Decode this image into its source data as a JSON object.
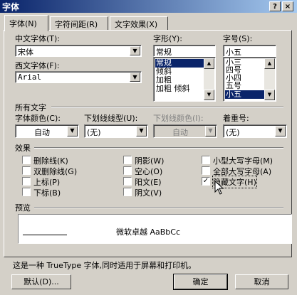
{
  "window": {
    "title": "字体",
    "help_glyph": "?",
    "close_glyph": "×"
  },
  "tabs": [
    {
      "label": "字体(N)",
      "active": true
    },
    {
      "label": "字符间距(R)",
      "active": false
    },
    {
      "label": "文字效果(X)",
      "active": false
    }
  ],
  "fields": {
    "chinese_font_label": "中文字体(T):",
    "chinese_font_value": "宋体",
    "western_font_label": "西文字体(F):",
    "western_font_value": "Arial",
    "style_label": "字形(Y):",
    "style_value": "常规",
    "style_options": [
      "常规",
      "倾斜",
      "加粗",
      "加粗 倾斜"
    ],
    "style_selected": "常规",
    "size_label": "字号(S):",
    "size_value": "小五",
    "size_options": [
      "小三",
      "四号",
      "小四",
      "五号",
      "小五"
    ],
    "size_selected": "小五"
  },
  "all_text": {
    "section_label": "所有文字",
    "font_color_label": "字体颜色(C):",
    "font_color_value": "自动",
    "underline_style_label": "下划线线型(U):",
    "underline_style_value": "(无)",
    "underline_color_label": "下划线颜色(I):",
    "underline_color_value": "自动",
    "emphasis_label": "着重号:",
    "emphasis_value": "(无)"
  },
  "effects": {
    "section_label": "效果",
    "items": [
      {
        "label": "删除线(K)",
        "checked": false
      },
      {
        "label": "双删除线(G)",
        "checked": false
      },
      {
        "label": "上标(P)",
        "checked": false
      },
      {
        "label": "下标(B)",
        "checked": false
      },
      {
        "label": "阴影(W)",
        "checked": false
      },
      {
        "label": "空心(O)",
        "checked": false
      },
      {
        "label": "阳文(E)",
        "checked": false
      },
      {
        "label": "阴文(V)",
        "checked": false
      },
      {
        "label": "小型大写字母(M)",
        "checked": false
      },
      {
        "label": "全部大写字母(A)",
        "checked": false
      },
      {
        "label": "隐藏文字(H)",
        "checked": true
      }
    ]
  },
  "preview": {
    "section_label": "预览",
    "sample_text": "微软卓越 AaBbCc"
  },
  "info_text": "这是一种 TrueType 字体,同时适用于屏幕和打印机。",
  "buttons": {
    "default_label": "默认(D)...",
    "ok_label": "确定",
    "cancel_label": "取消"
  }
}
